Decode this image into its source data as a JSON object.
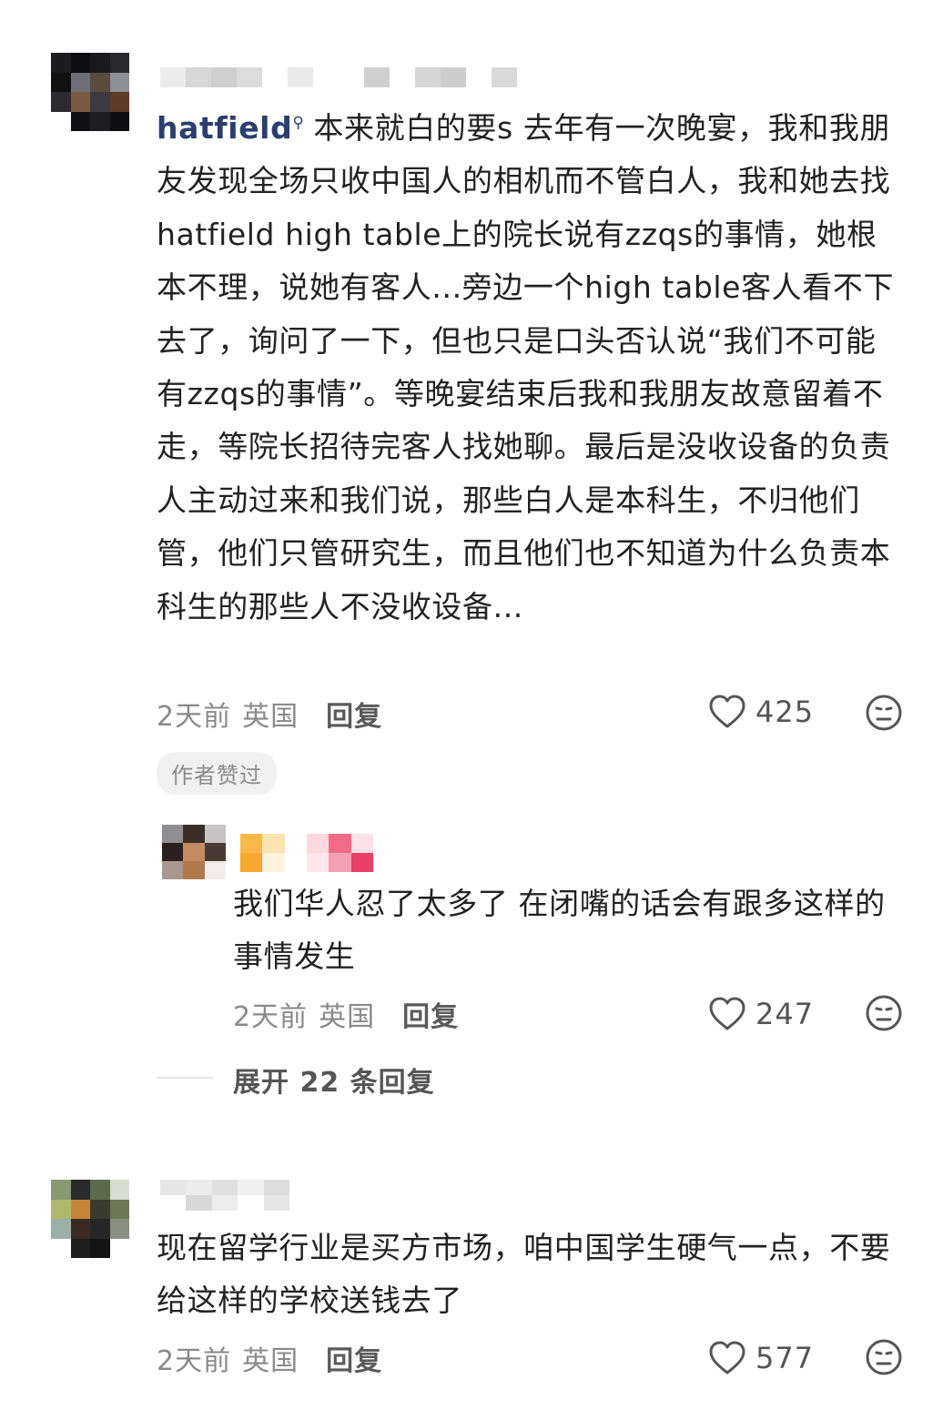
{
  "comments": [
    {
      "link_word": "hatfield",
      "text": "本来就白的要s 去年有一次晚宴，我和我朋友发现全场只收中国人的相机而不管白人，我和她去找hatfield high table上的院长说有zzqs的事情，她根本不理，说她有客人...旁边一个high table客人看不下去了，询问了一下，但也只是口头否认说“我们不可能有zzqs的事情”。等晚宴结束后我和我朋友故意留着不走，等院长招待完客人找她聊。最后是没收设备的负责人主动过来和我们说，那些白人是本科生，不归他们管，他们只管研究生，而且他们也不知道为什么负责本科生的那些人不没收设备...",
      "time": "2天前",
      "location": "英国",
      "reply_label": "回复",
      "likes": "425",
      "badge": "作者赞过"
    },
    {
      "text": "我们华人忍了太多了 在闭嘴的话会有跟多这样的事情发生",
      "time": "2天前",
      "location": "英国",
      "reply_label": "回复",
      "likes": "247",
      "expand_label": "展开 22 条回复"
    },
    {
      "text": "现在留学行业是买方市场，咱中国学生硬气一点，不要给这样的学校送钱去了",
      "time": "2天前",
      "location": "英国",
      "reply_label": "回复",
      "likes": "577"
    }
  ],
  "icons": {
    "like": "heart-outline-icon",
    "reaction": "neutral-face-icon",
    "search": "search-icon"
  },
  "colors": {
    "link": "#2b3e6e",
    "meta": "#8a8a8a",
    "text": "#222222"
  }
}
